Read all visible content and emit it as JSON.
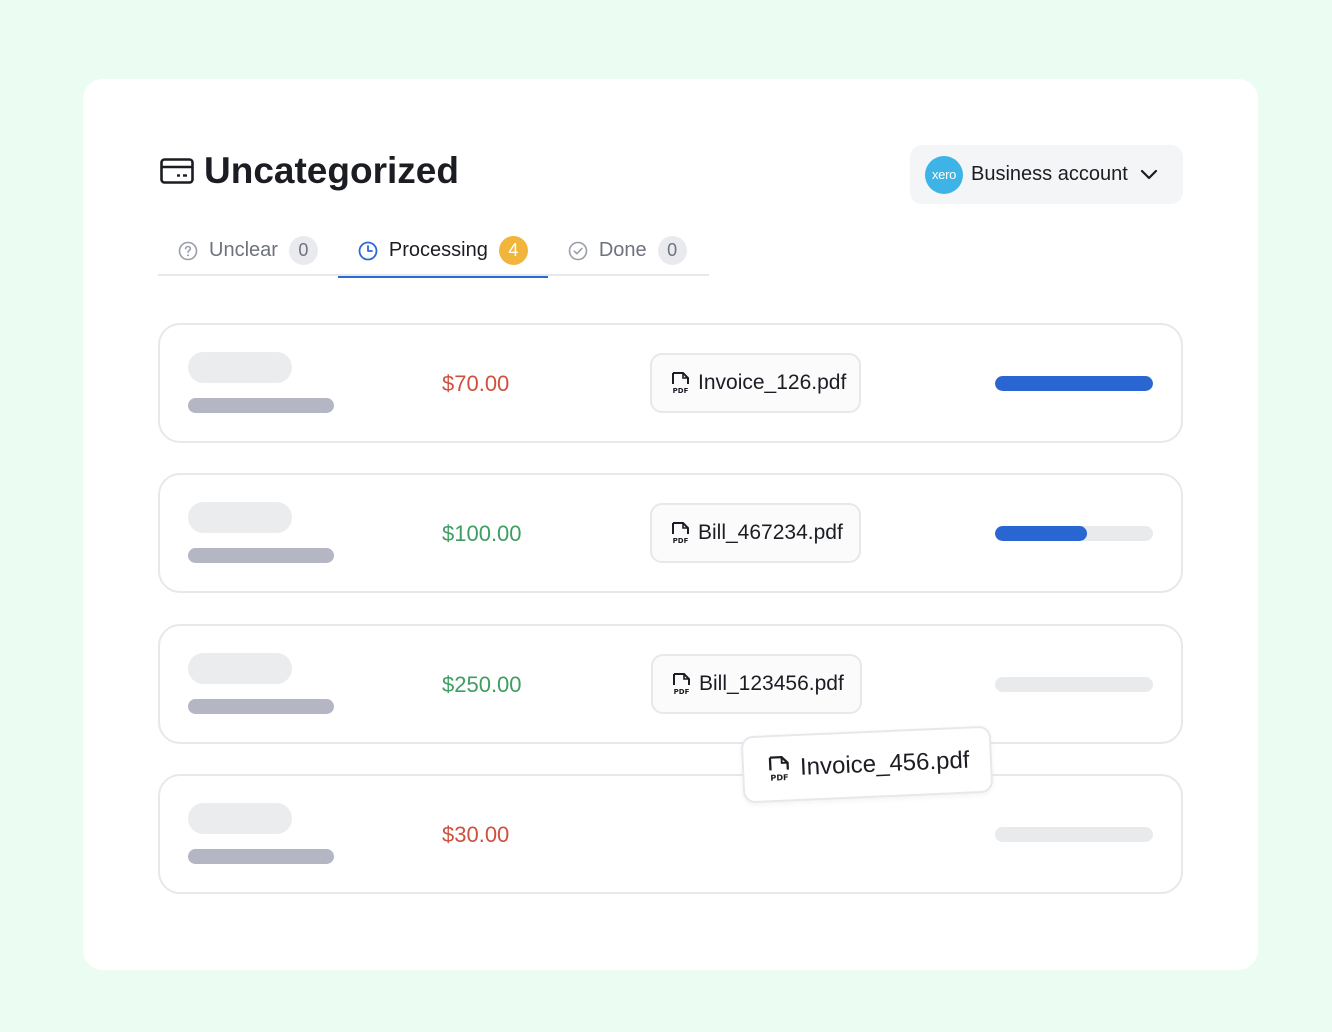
{
  "page": {
    "title": "Uncategorized",
    "title_icon": "card-icon"
  },
  "account": {
    "logo_text": "xero",
    "label": "Business account",
    "icon": "chevron-down-icon"
  },
  "tabs": [
    {
      "label": "Unclear",
      "count": "0",
      "icon": "question-circle-icon",
      "active": false
    },
    {
      "label": "Processing",
      "count": "4",
      "icon": "clock-icon",
      "active": true
    },
    {
      "label": "Done",
      "count": "0",
      "icon": "check-circle-icon",
      "active": false
    }
  ],
  "rows": [
    {
      "amount": "$70.00",
      "amount_type": "negative",
      "file": "Invoice_126.pdf",
      "progress": 1.0
    },
    {
      "amount": "$100.00",
      "amount_type": "positive",
      "file": "Bill_467234.pdf",
      "progress": 0.58
    },
    {
      "amount": "$250.00",
      "amount_type": "positive",
      "file": "Bill_123456.pdf",
      "progress": 0
    },
    {
      "amount": "$30.00",
      "amount_type": "negative",
      "file": "",
      "progress": 0
    }
  ],
  "dragged_file": {
    "label": "Invoice_456.pdf",
    "icon": "pdf-file-icon"
  },
  "colors": {
    "background": "#ebfcf3",
    "accent": "#2b6ad4",
    "badge_active": "#f2b53c",
    "negative": "#d0503f",
    "positive": "#3e9e62",
    "xero": "#3eb4e6"
  }
}
